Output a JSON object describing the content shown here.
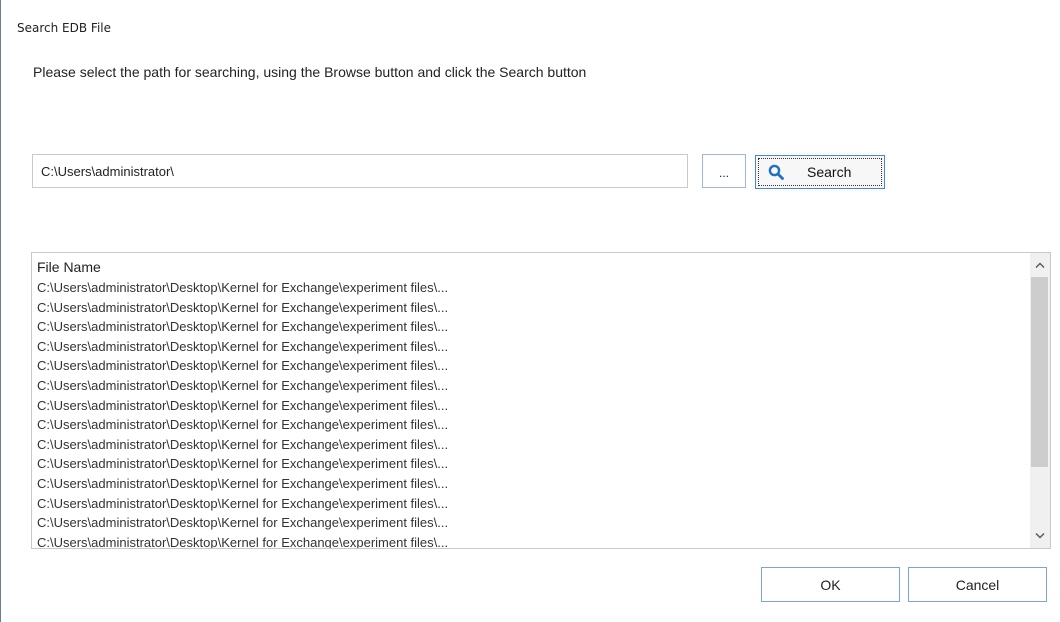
{
  "window": {
    "title": "Search EDB File"
  },
  "instructions": "Please select the path for searching, using the Browse button and click the Search button",
  "path_input": {
    "value": "C:\\Users\\administrator\\"
  },
  "browse_button": {
    "label": "..."
  },
  "search_button": {
    "label": "Search",
    "icon": "search-icon"
  },
  "file_list": {
    "header": "File Name",
    "rows": [
      "C:\\Users\\administrator\\Desktop\\Kernel for Exchange\\experiment files\\...",
      "C:\\Users\\administrator\\Desktop\\Kernel for Exchange\\experiment files\\...",
      "C:\\Users\\administrator\\Desktop\\Kernel for Exchange\\experiment files\\...",
      "C:\\Users\\administrator\\Desktop\\Kernel for Exchange\\experiment files\\...",
      "C:\\Users\\administrator\\Desktop\\Kernel for Exchange\\experiment files\\...",
      "C:\\Users\\administrator\\Desktop\\Kernel for Exchange\\experiment files\\...",
      "C:\\Users\\administrator\\Desktop\\Kernel for Exchange\\experiment files\\...",
      "C:\\Users\\administrator\\Desktop\\Kernel for Exchange\\experiment files\\...",
      "C:\\Users\\administrator\\Desktop\\Kernel for Exchange\\experiment files\\...",
      "C:\\Users\\administrator\\Desktop\\Kernel for Exchange\\experiment files\\...",
      "C:\\Users\\administrator\\Desktop\\Kernel for Exchange\\experiment files\\...",
      "C:\\Users\\administrator\\Desktop\\Kernel for Exchange\\experiment files\\...",
      "C:\\Users\\administrator\\Desktop\\Kernel for Exchange\\experiment files\\...",
      "C:\\Users\\administrator\\Desktop\\Kernel for Exchange\\experiment files\\..."
    ]
  },
  "buttons": {
    "ok": "OK",
    "cancel": "Cancel"
  },
  "colors": {
    "accent": "#4a86d8",
    "search_icon": "#1f6fc5"
  }
}
